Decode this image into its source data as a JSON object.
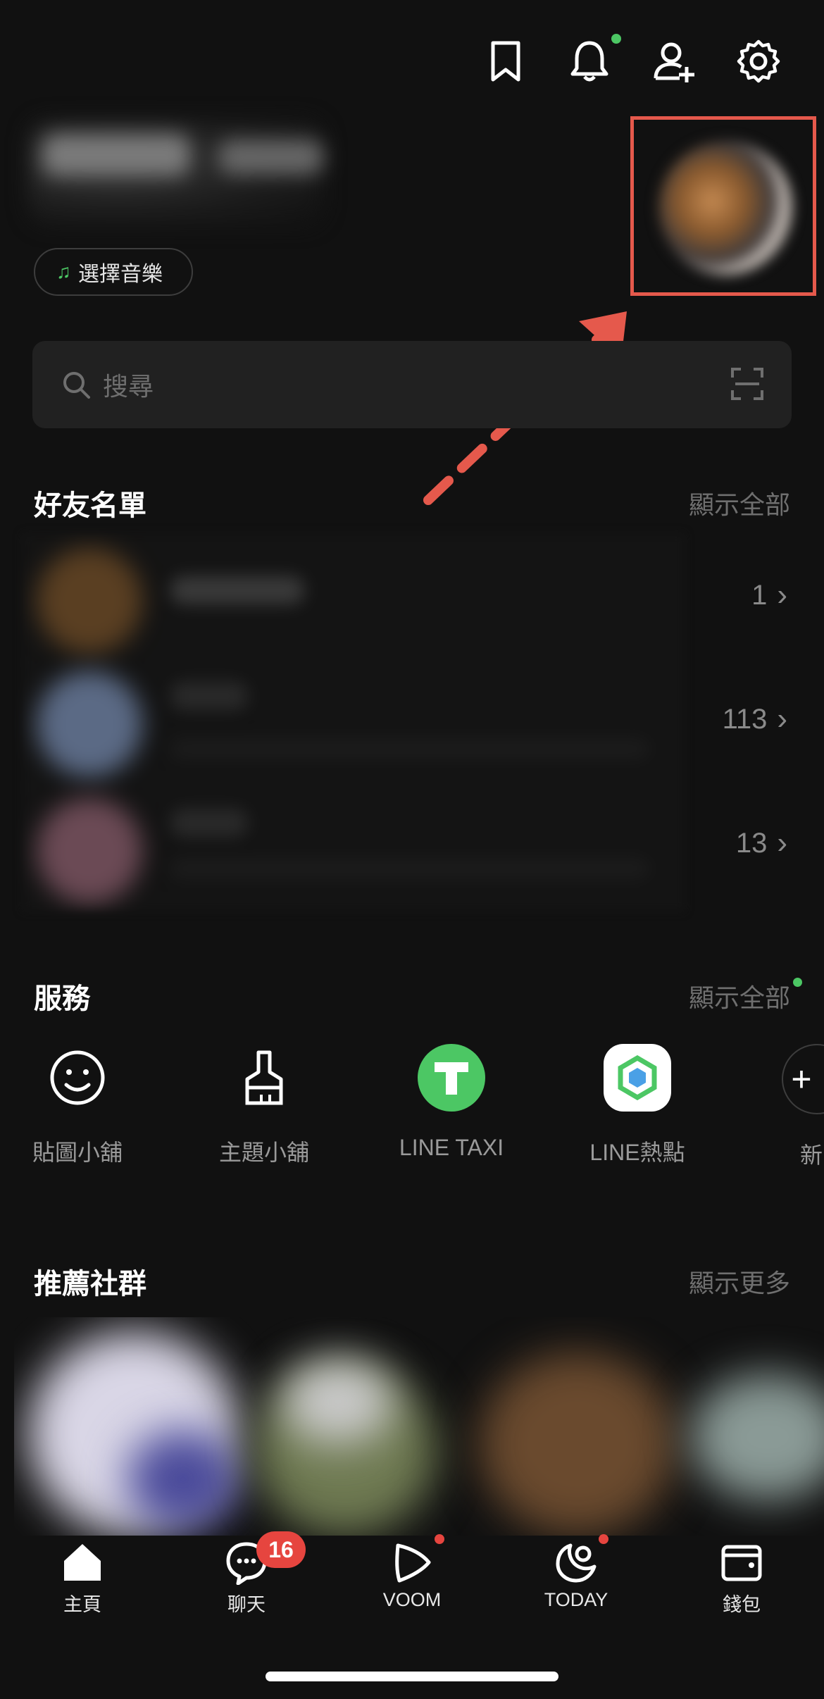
{
  "header": {
    "bookmark_icon": "bookmark-icon",
    "bell_icon": "bell-icon",
    "add_friend_icon": "add-friend-icon",
    "settings_icon": "gear-icon"
  },
  "profile": {
    "music_label": "選擇音樂"
  },
  "search": {
    "placeholder": "搜尋"
  },
  "friends": {
    "title": "好友名單",
    "show_all": "顯示全部",
    "rows": [
      {
        "count": "1"
      },
      {
        "count": "113"
      },
      {
        "count": "13"
      }
    ]
  },
  "services": {
    "title": "服務",
    "show_all": "顯示全部",
    "items": [
      {
        "label": "貼圖小舖",
        "icon": "smiley-icon"
      },
      {
        "label": "主題小舖",
        "icon": "brush-icon"
      },
      {
        "label": "LINE TAXI",
        "icon": "taxi-icon"
      },
      {
        "label": "LINE熱點",
        "icon": "hotspot-icon"
      },
      {
        "label": "新",
        "icon": "plus-icon"
      }
    ]
  },
  "community": {
    "title": "推薦社群",
    "show_more": "顯示更多"
  },
  "tabs": [
    {
      "label": "主頁",
      "icon": "home-icon"
    },
    {
      "label": "聊天",
      "icon": "chat-icon",
      "badge": "16"
    },
    {
      "label": "VOOM",
      "icon": "voom-icon"
    },
    {
      "label": "TODAY",
      "icon": "today-icon"
    },
    {
      "label": "錢包",
      "icon": "wallet-icon"
    }
  ],
  "colors": {
    "background": "#111111",
    "accent_green": "#4cc764",
    "highlight_red": "#e5594c",
    "badge_red": "#e6453f"
  }
}
